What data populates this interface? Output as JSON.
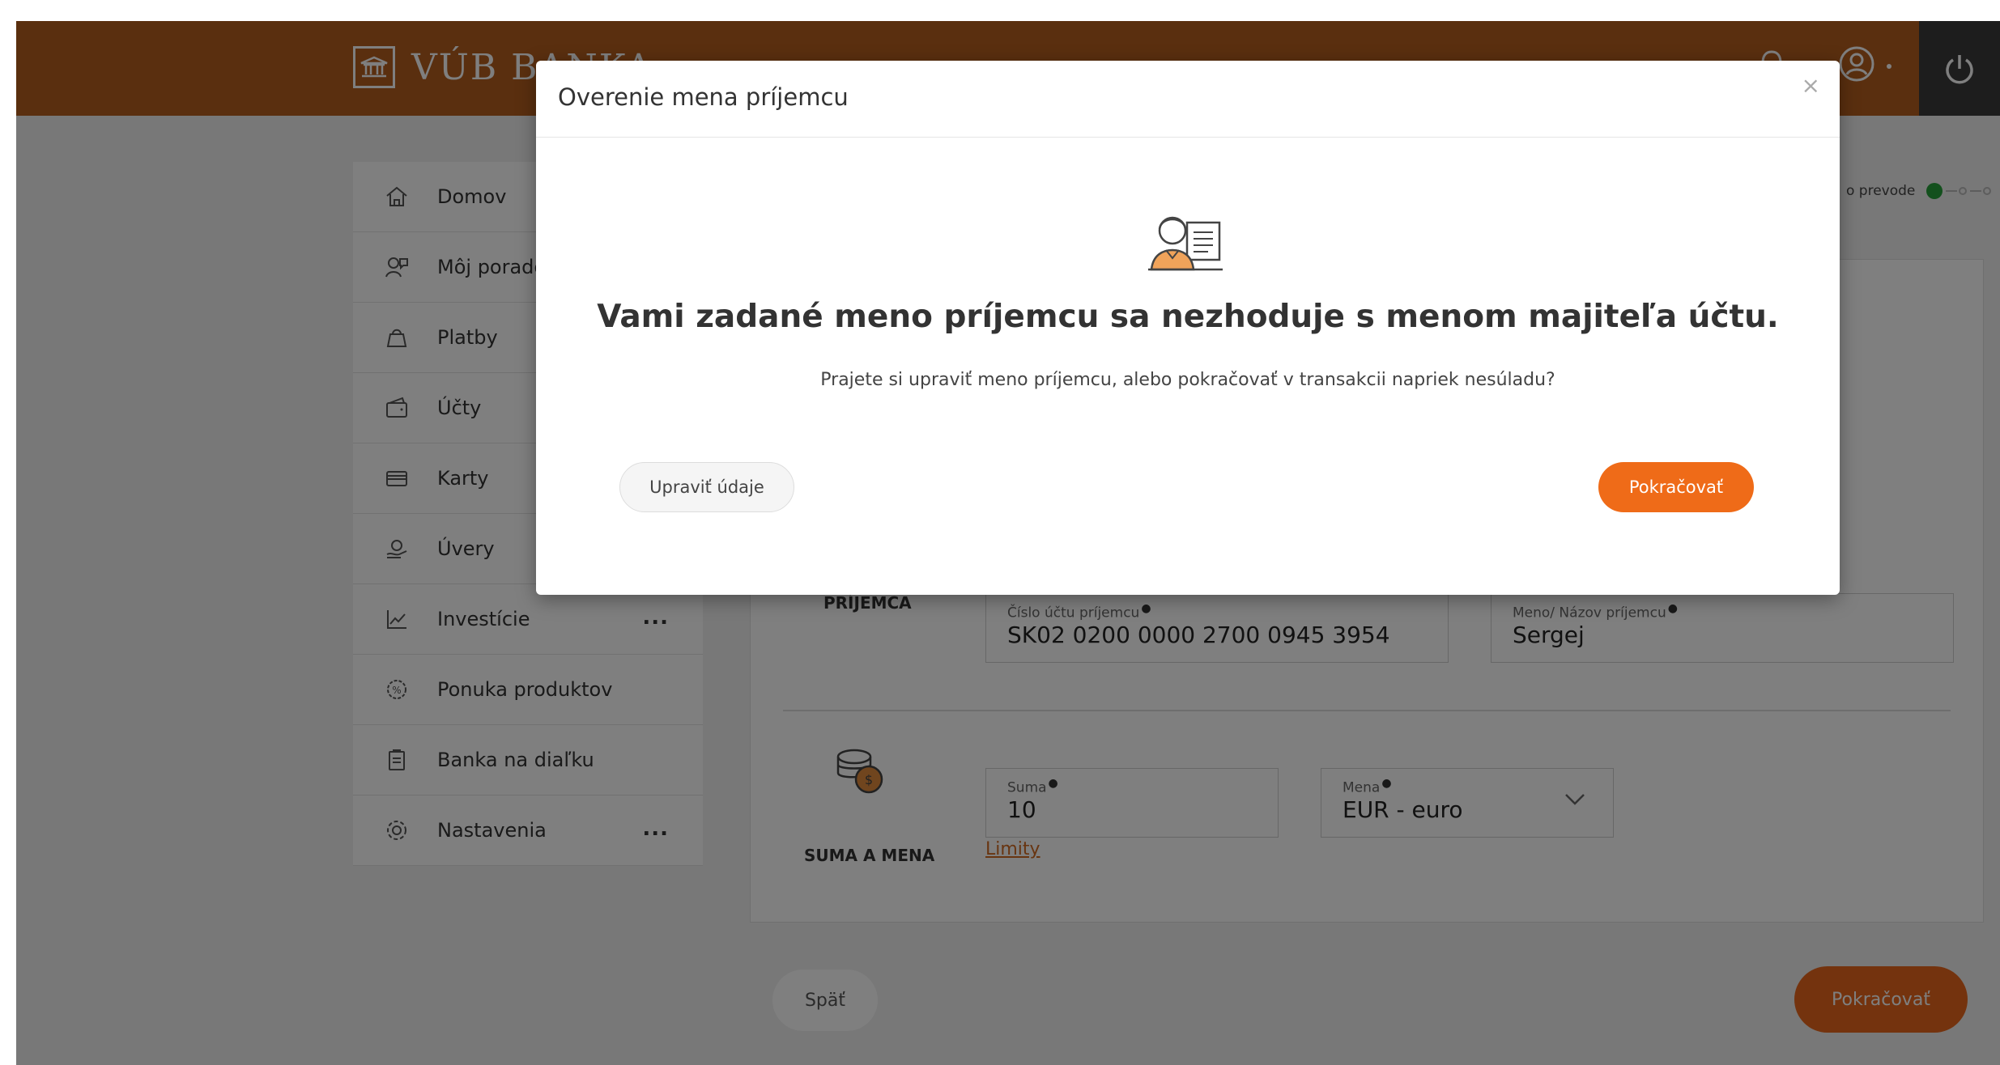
{
  "brand": {
    "name": "VÚB BANKA"
  },
  "colors": {
    "header": "#b55e1e",
    "accent": "#ef6b18",
    "power_bg": "#3a3a3a",
    "step_active": "#27a13a"
  },
  "header_icons": [
    "bell-icon",
    "user-icon",
    "power-icon"
  ],
  "sidebar": {
    "items": [
      {
        "label": "Domov",
        "icon": "home-icon"
      },
      {
        "label": "Môj poradca",
        "icon": "advisor-icon"
      },
      {
        "label": "Platby",
        "icon": "payments-icon"
      },
      {
        "label": "Účty",
        "icon": "wallet-icon"
      },
      {
        "label": "Karty",
        "icon": "card-icon"
      },
      {
        "label": "Úvery",
        "icon": "loan-icon"
      },
      {
        "label": "Investície",
        "icon": "chart-icon",
        "more": "..."
      },
      {
        "label": "Ponuka produktov",
        "icon": "offer-icon"
      },
      {
        "label": "Banka na diaľku",
        "icon": "clipboard-icon"
      },
      {
        "label": "Nastavenia",
        "icon": "gear-icon",
        "more": "..."
      }
    ]
  },
  "steps": {
    "label": "o prevode"
  },
  "form": {
    "recipient_section": "PRÍJEMCA",
    "account_label": "Číslo účtu príjemcu",
    "account_value": "SK02 0200 0000 2700 0945 3954",
    "name_label": "Meno/ Názov príjemcu",
    "name_value": "Sergej",
    "amount_section": "SUMA A MENA",
    "amount_label": "Suma",
    "amount_value": "10",
    "currency_label": "Mena",
    "currency_value": "EUR - euro",
    "limits_link": "Limity",
    "back_label": "Späť",
    "continue_label": "Pokračovať"
  },
  "modal": {
    "title": "Overenie mena príjemcu",
    "close": "×",
    "heading": "Vami zadané meno príjemcu sa nezhoduje s menom majiteľa účtu.",
    "subtext": "Prajete si upraviť meno príjemcu, alebo pokračovať v transakcii napriek nesúladu?",
    "edit_label": "Upraviť údaje",
    "continue_label": "Pokračovať"
  }
}
